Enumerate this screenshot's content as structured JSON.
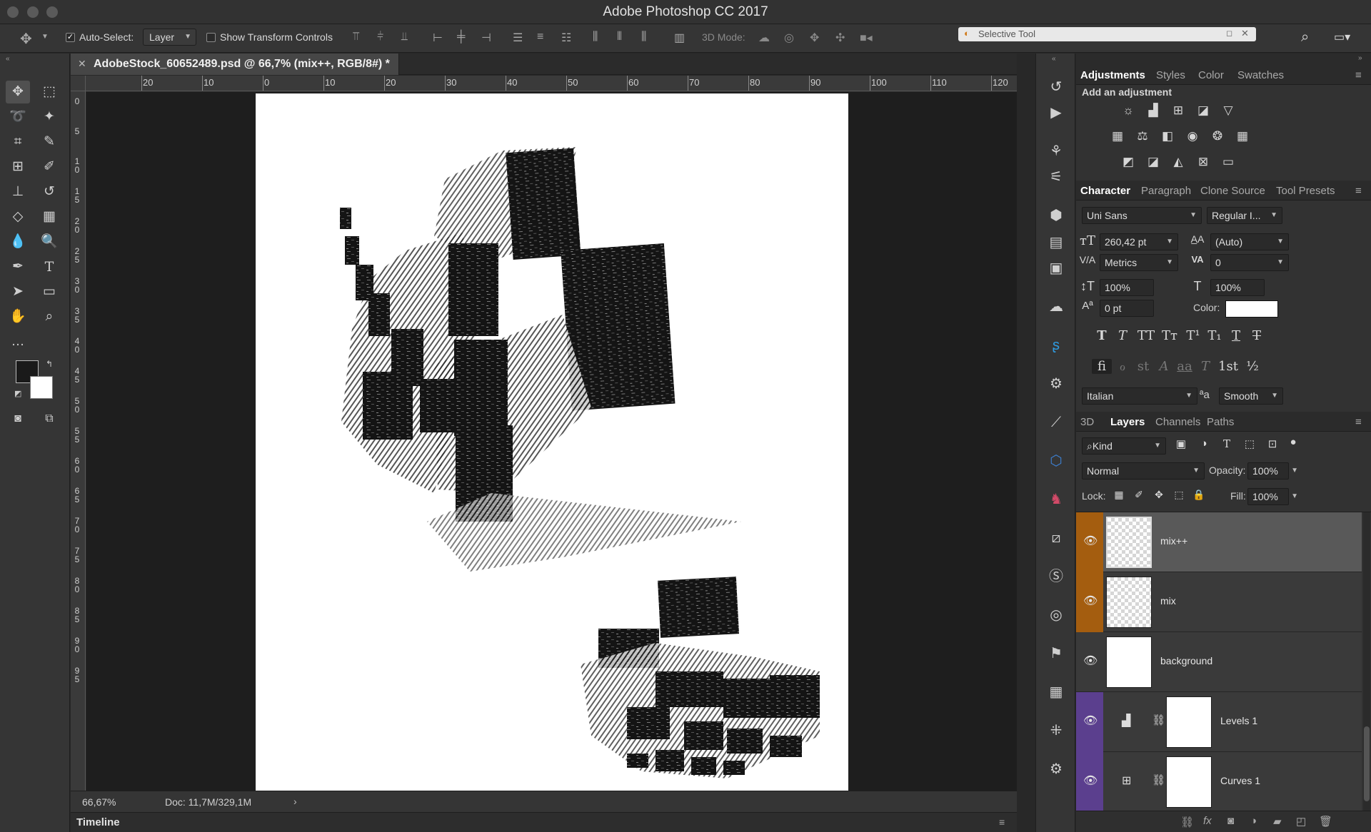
{
  "app": {
    "title": "Adobe Photoshop CC 2017"
  },
  "options_bar": {
    "auto_select_label": "Auto-Select:",
    "auto_select_value": "Layer",
    "show_transform_label": "Show Transform Controls",
    "mode_3d_label": "3D Mode:",
    "selective_tool": "Selective Tool"
  },
  "document": {
    "tab_title": "AdobeStock_60652489.psd @ 66,7% (mix++, RGB/8#) *",
    "zoom": "66,67%",
    "doc_size": "Doc: 11,7M/329,1M",
    "ruler_top": [
      "20",
      "10",
      "0",
      "10",
      "20",
      "30",
      "40",
      "50",
      "60",
      "70",
      "80",
      "90",
      "100",
      "110",
      "120"
    ],
    "ruler_left": [
      "0",
      "5",
      "1 0",
      "1 5",
      "2 0",
      "2 5",
      "3 0",
      "3 5",
      "4 0",
      "4 5",
      "5 0",
      "5 5",
      "6 0",
      "6 5",
      "7 0",
      "7 5",
      "8 0",
      "8 5",
      "9 0",
      "9 5"
    ]
  },
  "timeline": {
    "label": "Timeline"
  },
  "adjustments_panel": {
    "tabs": [
      "Adjustments",
      "Styles",
      "Color",
      "Swatches"
    ],
    "heading": "Add an adjustment",
    "row1": [
      "brightness-icon",
      "levels-icon",
      "curves-icon",
      "exposure-icon",
      "vibrance-icon"
    ],
    "row2": [
      "hue-saturation-icon",
      "color-balance-icon",
      "black-white-icon",
      "photo-filter-icon",
      "channel-mixer-icon",
      "color-lookup-icon"
    ],
    "row3": [
      "invert-icon",
      "posterize-icon",
      "threshold-icon",
      "selective-color-icon",
      "gradient-map-icon"
    ]
  },
  "character_panel": {
    "tabs": [
      "Character",
      "Paragraph",
      "Clone Source",
      "Tool Presets"
    ],
    "font_family": "Uni Sans",
    "font_style": "Regular I...",
    "font_size": "260,42 pt",
    "leading": "(Auto)",
    "kerning": "Metrics",
    "tracking": "0",
    "vertical_scale": "100%",
    "horizontal_scale": "100%",
    "baseline_shift": "0 pt",
    "color_label": "Color:",
    "language": "Italian",
    "antialias": "Smooth",
    "antialias_glyph": "ªa",
    "style_glyphs": [
      "T",
      "T",
      "TT",
      "Tт",
      "T¹",
      "T₁",
      "T",
      "T"
    ],
    "opentype_glyphs": [
      "ﬁ",
      "ℴ",
      "st",
      "A",
      "aa",
      "T",
      "1st",
      "½"
    ]
  },
  "layers_panel": {
    "tabs": [
      "3D",
      "Layers",
      "Channels",
      "Paths"
    ],
    "filter_kind": "Kind",
    "blend_mode": "Normal",
    "opacity_label": "Opacity:",
    "opacity": "100%",
    "lock_label": "Lock:",
    "fill_label": "Fill:",
    "fill": "100%",
    "layers": [
      {
        "name": "mix++",
        "color": "#a45d0f"
      },
      {
        "name": "mix",
        "color": "#a45d0f"
      },
      {
        "name": "background",
        "color": ""
      },
      {
        "name": "Levels 1",
        "color": "#5b3f8e"
      },
      {
        "name": "Curves 1",
        "color": "#5b3f8e"
      }
    ]
  },
  "colors": {
    "accent_orange": "#a45d0f",
    "accent_purple": "#5b3f8e"
  }
}
